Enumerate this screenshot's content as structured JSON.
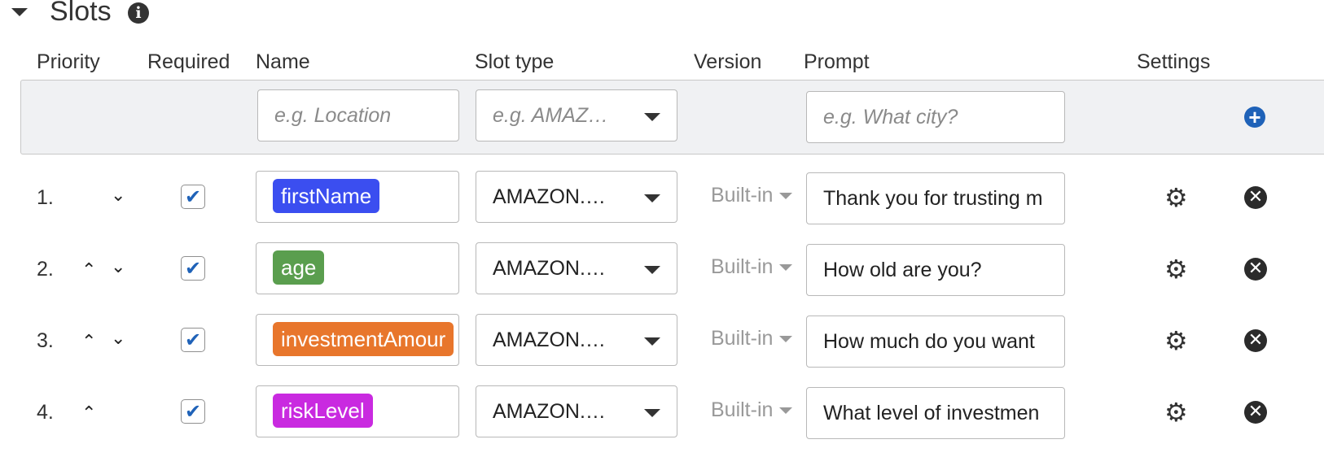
{
  "section": {
    "title": "Slots",
    "info_icon": "i"
  },
  "columns": {
    "priority": "Priority",
    "required": "Required",
    "name": "Name",
    "slot_type": "Slot type",
    "version": "Version",
    "prompt": "Prompt",
    "settings": "Settings"
  },
  "new_slot": {
    "name_placeholder": "e.g. Location",
    "slot_type_placeholder": "e.g. AMAZ…",
    "prompt_placeholder": "e.g. What city?",
    "add_icon": "+"
  },
  "slots": [
    {
      "number": "1.",
      "up": "",
      "down": "⌄",
      "checked": "✔",
      "name": "firstName",
      "tag_color": "#3b4ef0",
      "slot_type": "AMAZON.…",
      "version": "Built-in",
      "prompt": "Thank you for trusting m"
    },
    {
      "number": "2.",
      "up": "⌃",
      "down": "⌄",
      "checked": "✔",
      "name": "age",
      "tag_color": "#5a9e4e",
      "slot_type": "AMAZON.…",
      "version": "Built-in",
      "prompt": "How old are you?"
    },
    {
      "number": "3.",
      "up": "⌃",
      "down": "⌄",
      "checked": "✔",
      "name": "investmentAmour",
      "tag_color": "#e8762c",
      "slot_type": "AMAZON.…",
      "version": "Built-in",
      "prompt": "How much do you want"
    },
    {
      "number": "4.",
      "up": "⌃",
      "down": "",
      "checked": "✔",
      "name": "riskLevel",
      "tag_color": "#c92ae0",
      "slot_type": "AMAZON.…",
      "version": "Built-in",
      "prompt": "What level of investmen"
    }
  ],
  "icons": {
    "settings": "gear-icon",
    "remove": "remove-icon",
    "gear_glyph": "⚙",
    "remove_glyph": "✕"
  }
}
